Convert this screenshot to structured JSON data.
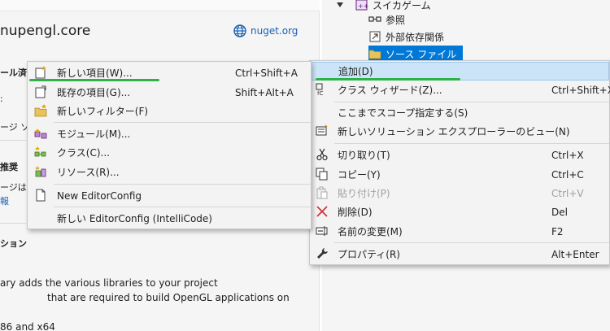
{
  "package": {
    "title": "nupengl.core",
    "nuget_link": "nuget.org",
    "frag_installed": "ール済み",
    "frag_colon": ":",
    "frag_package": "ージ ソ",
    "frag_recommend": "推奨",
    "frag_package2": "ージは",
    "frag_link": "報",
    "frag_option": "ション",
    "desc_line1": "ary adds the various libraries to your project",
    "desc_line2": "that are required to build OpenGL applications on",
    "desc_line3": "86 and x64"
  },
  "solution_tree": {
    "project_label": "スイカゲーム",
    "references": "参照",
    "external_deps": "外部依存関係",
    "source_files": "ソース ファイル"
  },
  "context_menu": {
    "items": [
      {
        "label": "追加(D)",
        "shortcut": "",
        "icon": "none",
        "state": "highlighted"
      },
      {
        "label": "クラス ウィザード(Z)...",
        "shortcut": "Ctrl+Shift+X",
        "icon": "class-wizard-icon",
        "state": "normal"
      },
      {
        "label": "ここまでスコープ指定する(S)",
        "shortcut": "",
        "icon": "none",
        "state": "normal"
      },
      {
        "label": "新しいソリューション エクスプローラーのビュー(N)",
        "shortcut": "",
        "icon": "new-view-icon",
        "state": "normal"
      },
      {
        "label": "切り取り(T)",
        "shortcut": "Ctrl+X",
        "icon": "cut-icon",
        "state": "normal"
      },
      {
        "label": "コピー(Y)",
        "shortcut": "Ctrl+C",
        "icon": "copy-icon",
        "state": "normal"
      },
      {
        "label": "貼り付け(P)",
        "shortcut": "Ctrl+V",
        "icon": "paste-icon",
        "state": "disabled"
      },
      {
        "label": "削除(D)",
        "shortcut": "Del",
        "icon": "delete-icon",
        "state": "normal"
      },
      {
        "label": "名前の変更(M)",
        "shortcut": "F2",
        "icon": "rename-icon",
        "state": "normal"
      },
      {
        "label": "プロパティ(R)",
        "shortcut": "Alt+Enter",
        "icon": "wrench-icon",
        "state": "normal"
      }
    ]
  },
  "add_submenu": {
    "items": [
      {
        "label": "新しい項目(W)...",
        "shortcut": "Ctrl+Shift+A",
        "icon": "new-item-icon"
      },
      {
        "label": "既存の項目(G)...",
        "shortcut": "Shift+Alt+A",
        "icon": "existing-item-icon"
      },
      {
        "label": "新しいフィルター(F)",
        "shortcut": "",
        "icon": "new-filter-icon"
      },
      {
        "label": "モジュール(M)...",
        "shortcut": "",
        "icon": "module-icon"
      },
      {
        "label": "クラス(C)...",
        "shortcut": "",
        "icon": "class-icon"
      },
      {
        "label": "リソース(R)...",
        "shortcut": "",
        "icon": "resource-icon"
      },
      {
        "label": "New EditorConfig",
        "shortcut": "",
        "icon": "editorconfig-icon"
      },
      {
        "label": "新しい EditorConfig (IntelliCode)",
        "shortcut": "",
        "icon": "none"
      }
    ]
  },
  "colors": {
    "selection_blue": "#0078d7",
    "menu_highlight": "#cce4f7",
    "annotation_green": "#2fb14a",
    "link_blue": "#1a5fb4"
  }
}
